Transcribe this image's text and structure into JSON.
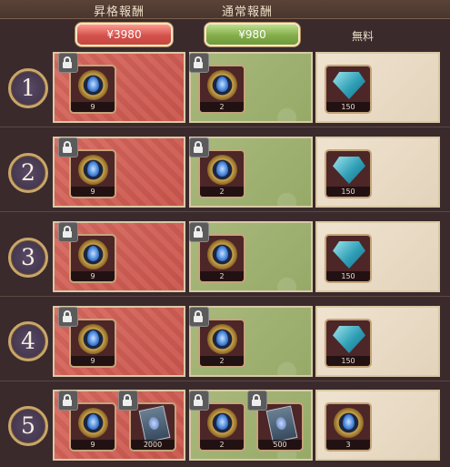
{
  "header": {
    "premium_tab": "昇格報酬",
    "normal_tab": "通常報酬"
  },
  "prices": {
    "premium": "¥3980",
    "normal": "¥980",
    "free": "無料"
  },
  "tiers": [
    {
      "number": "1",
      "premium": [
        {
          "icon": "medal-icon",
          "qty": "9",
          "locked": true
        }
      ],
      "normal": [
        {
          "icon": "medal-icon",
          "qty": "2",
          "locked": true
        }
      ],
      "free": [
        {
          "icon": "gem-icon",
          "qty": "150"
        }
      ]
    },
    {
      "number": "2",
      "premium": [
        {
          "icon": "medal-icon",
          "qty": "9",
          "locked": true
        }
      ],
      "normal": [
        {
          "icon": "medal-icon",
          "qty": "2",
          "locked": true
        }
      ],
      "free": [
        {
          "icon": "gem-icon",
          "qty": "150"
        }
      ]
    },
    {
      "number": "3",
      "premium": [
        {
          "icon": "medal-icon",
          "qty": "9",
          "locked": true
        }
      ],
      "normal": [
        {
          "icon": "medal-icon",
          "qty": "2",
          "locked": true
        }
      ],
      "free": [
        {
          "icon": "gem-icon",
          "qty": "150"
        }
      ]
    },
    {
      "number": "4",
      "premium": [
        {
          "icon": "medal-icon",
          "qty": "9",
          "locked": true
        }
      ],
      "normal": [
        {
          "icon": "medal-icon",
          "qty": "2",
          "locked": true
        }
      ],
      "free": [
        {
          "icon": "gem-icon",
          "qty": "150"
        }
      ]
    },
    {
      "number": "5",
      "premium": [
        {
          "icon": "medal-icon",
          "qty": "9",
          "locked": true
        },
        {
          "icon": "card-icon",
          "qty": "2000",
          "locked": true
        }
      ],
      "normal": [
        {
          "icon": "medal-icon",
          "qty": "2",
          "locked": true
        },
        {
          "icon": "card-icon",
          "qty": "500",
          "locked": true
        }
      ],
      "free": [
        {
          "icon": "medal-icon",
          "qty": "3"
        }
      ]
    }
  ],
  "colors": {
    "premium": "#d0635a",
    "normal": "#9fb172",
    "free": "#e9dbc5",
    "background": "#3a2a2c"
  }
}
